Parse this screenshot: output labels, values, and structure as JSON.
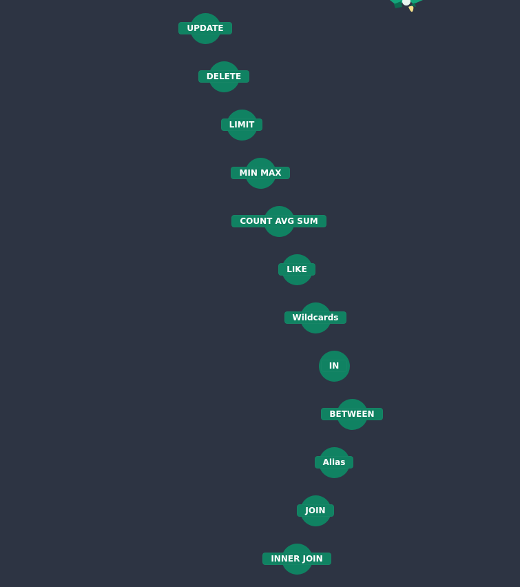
{
  "colors": {
    "background": "#2d3443",
    "node": "#108262",
    "text": "#ffffff"
  },
  "mascot": {
    "icon": "rocket-mascot-icon"
  },
  "lessons": [
    {
      "label": "UPDATE"
    },
    {
      "label": "DELETE"
    },
    {
      "label": "LIMIT"
    },
    {
      "label": "MIN MAX"
    },
    {
      "label": "COUNT AVG SUM"
    },
    {
      "label": "LIKE"
    },
    {
      "label": "Wildcards"
    },
    {
      "label": "IN"
    },
    {
      "label": "BETWEEN"
    },
    {
      "label": "Alias"
    },
    {
      "label": "JOIN"
    },
    {
      "label": "INNER JOIN"
    }
  ]
}
